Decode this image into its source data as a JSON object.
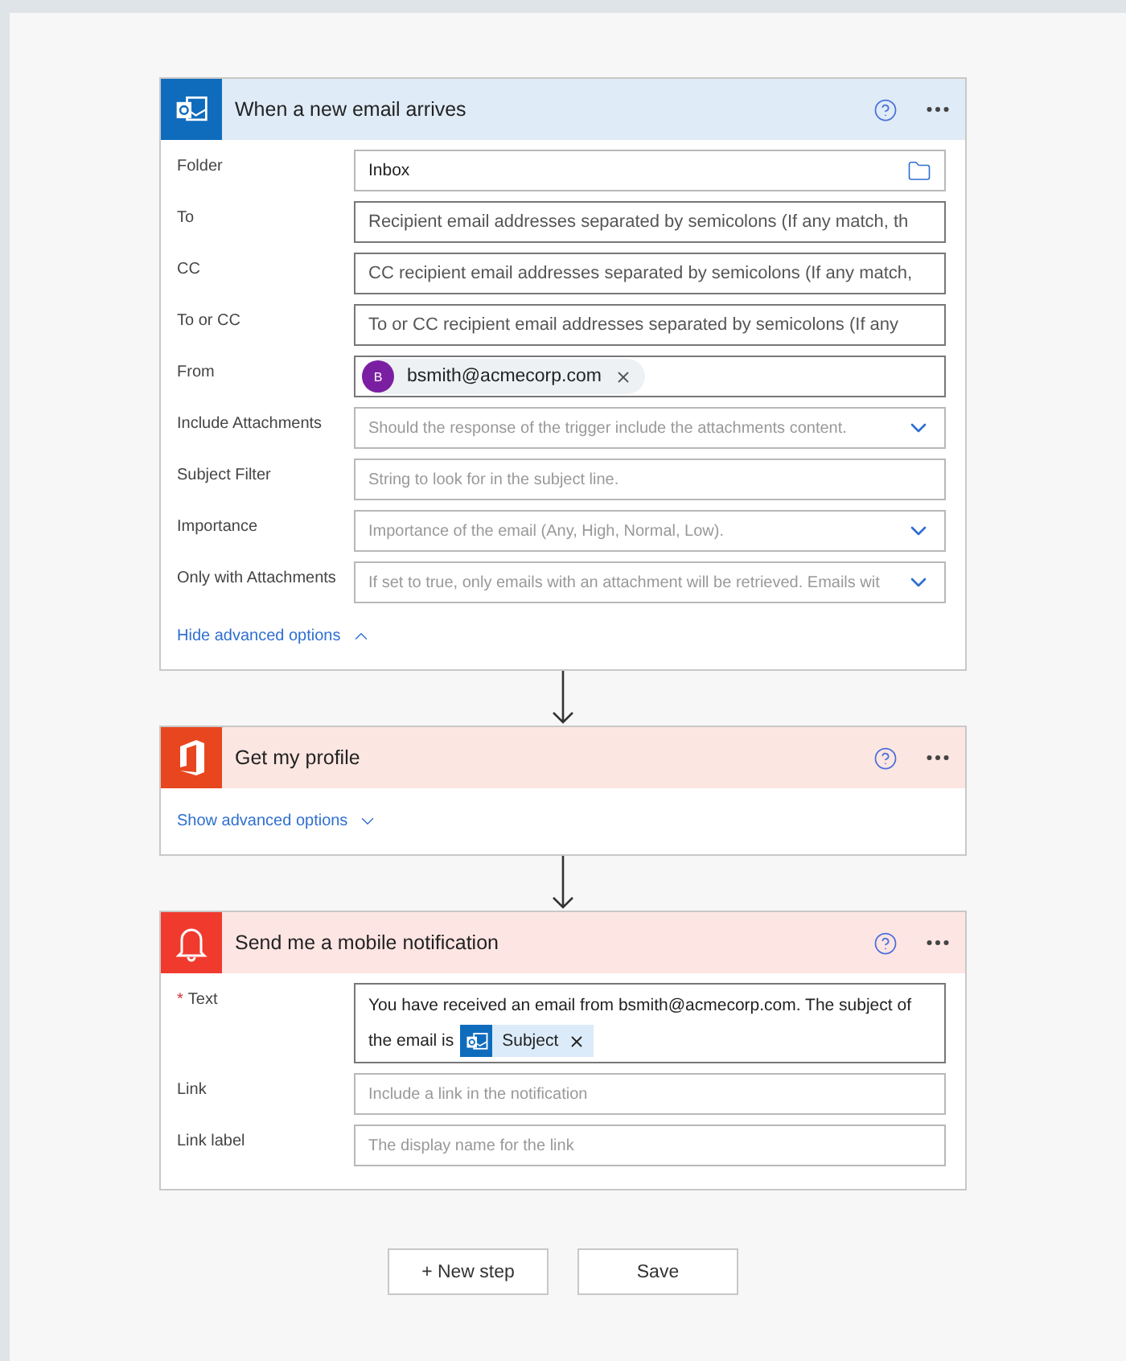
{
  "cards": [
    {
      "kind": "mail",
      "color": "#0f6cbd",
      "title": "When a new email arrives",
      "fields": [
        {
          "label": "Folder",
          "kind": "folder",
          "value": "Inbox"
        },
        {
          "label": "To",
          "kind": "address",
          "placeholder": "Recipient email addresses separated by semicolons (If any match, th"
        },
        {
          "label": "CC",
          "kind": "address",
          "placeholder": "CC recipient email addresses separated by semicolons (If any match,"
        },
        {
          "label": "To or CC",
          "kind": "address",
          "placeholder": "To or CC recipient email addresses separated by semicolons (If any"
        },
        {
          "label": "From",
          "kind": "token",
          "avatar": "B",
          "value": "bsmith@acmecorp.com"
        },
        {
          "label": "Include Attachments",
          "kind": "dropdown",
          "placeholder": "Should the response of the trigger include the attachments content."
        },
        {
          "label": "Subject Filter",
          "kind": "text",
          "placeholder": "String to look for in the subject line."
        },
        {
          "label": "Importance",
          "kind": "dropdown",
          "placeholder": "Importance of the email (Any, High, Normal, Low)."
        },
        {
          "label": "Only with Attachments",
          "kind": "dropdown",
          "placeholder": "If set to true, only emails with an attachment will be retrieved. Emails wit"
        }
      ],
      "advanced": {
        "label": "Hide advanced options",
        "expanded": true
      }
    },
    {
      "kind": "office",
      "color": "#e8461e",
      "title": "Get my profile",
      "advanced": {
        "label": "Show advanced options",
        "expanded": false
      }
    },
    {
      "kind": "bell",
      "color": "#f03a2e",
      "title": "Send me a mobile notification",
      "fields": [
        {
          "label": "Text",
          "required_mark": "*",
          "kind": "message",
          "value": "You have received an email from bsmith@acmecorp.com. The subject of the email is",
          "chip": "Subject"
        },
        {
          "label": "Link",
          "kind": "text",
          "placeholder": "Include a link in the notification"
        },
        {
          "label": "Link label",
          "kind": "text",
          "placeholder": "The display name for the link"
        }
      ]
    }
  ],
  "buttons": [
    "+ New step",
    "Save"
  ]
}
